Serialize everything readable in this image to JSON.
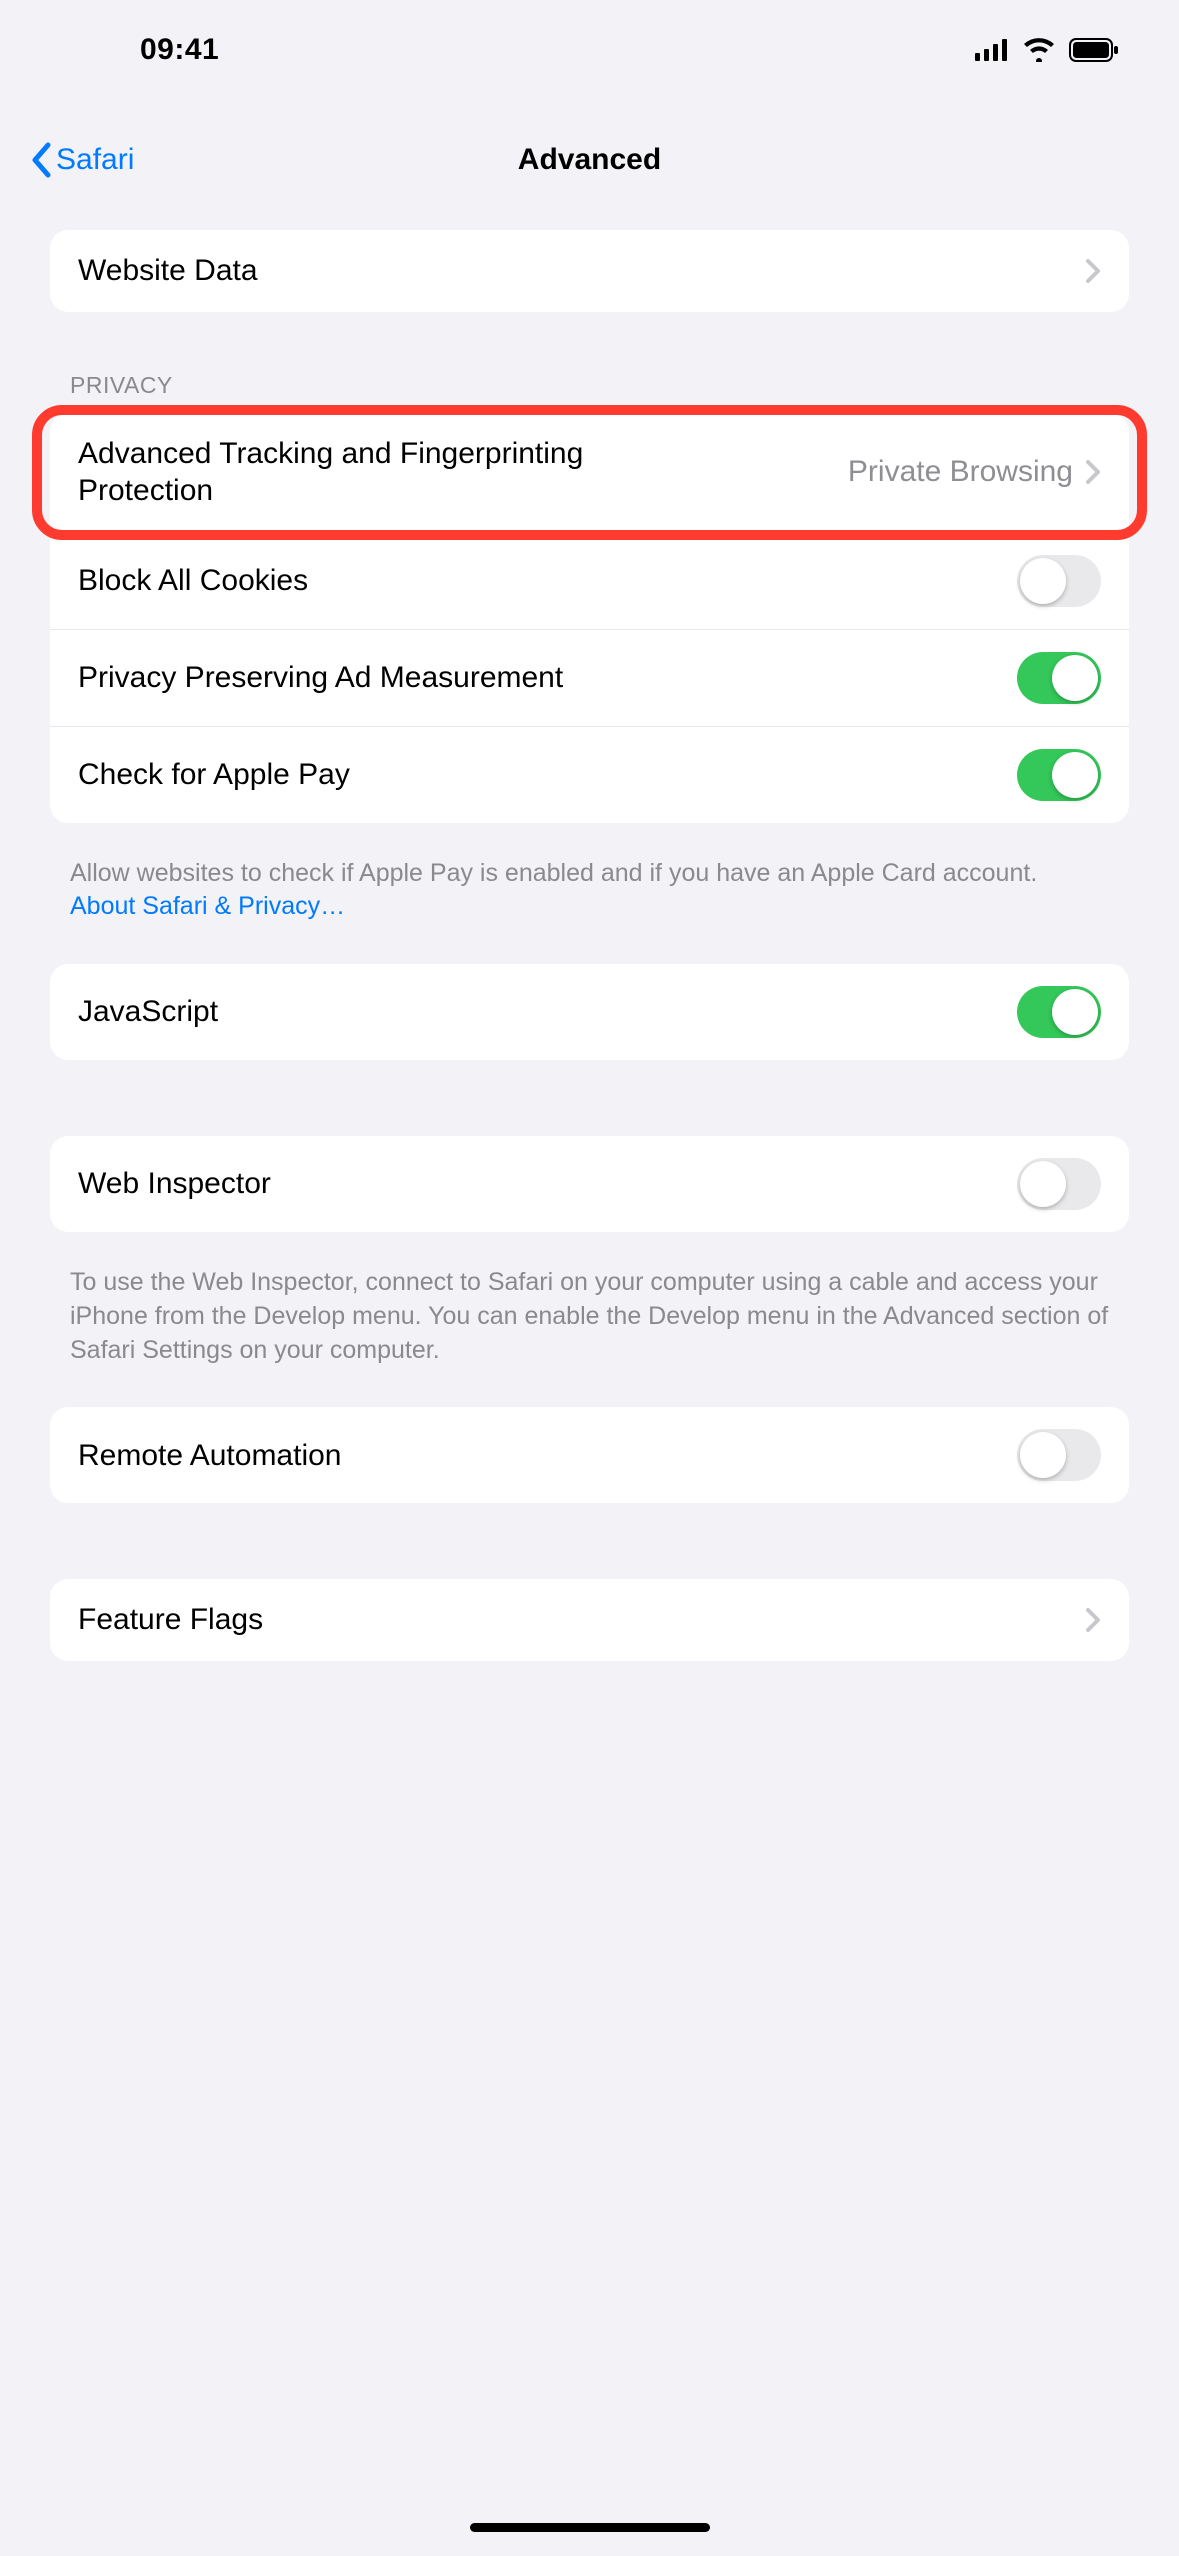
{
  "status": {
    "time": "09:41"
  },
  "nav": {
    "back": "Safari",
    "title": "Advanced"
  },
  "groups": {
    "websiteData": {
      "label": "Website Data"
    },
    "privacyHeader": "Privacy",
    "tracking": {
      "label": "Advanced Tracking and Fingerprinting Protection",
      "value": "Private Browsing"
    },
    "blockCookies": {
      "label": "Block All Cookies",
      "on": false
    },
    "adMeasure": {
      "label": "Privacy Preserving Ad Measurement",
      "on": true
    },
    "applePay": {
      "label": "Check for Apple Pay",
      "on": true
    },
    "privacyFooter": "Allow websites to check if Apple Pay is enabled and if you have an Apple Card account.",
    "privacyLink": "About Safari & Privacy…",
    "javascript": {
      "label": "JavaScript",
      "on": true
    },
    "webInspector": {
      "label": "Web Inspector",
      "on": false
    },
    "webInspectorFooter": "To use the Web Inspector, connect to Safari on your computer using a cable and access your iPhone from the Develop menu. You can enable the Develop menu in the Advanced section of Safari Settings on your computer.",
    "remoteAutomation": {
      "label": "Remote Automation",
      "on": false
    },
    "featureFlags": {
      "label": "Feature Flags"
    }
  },
  "colors": {
    "accent": "#007aff",
    "toggleOn": "#34c759",
    "highlight": "#ff3b30"
  }
}
